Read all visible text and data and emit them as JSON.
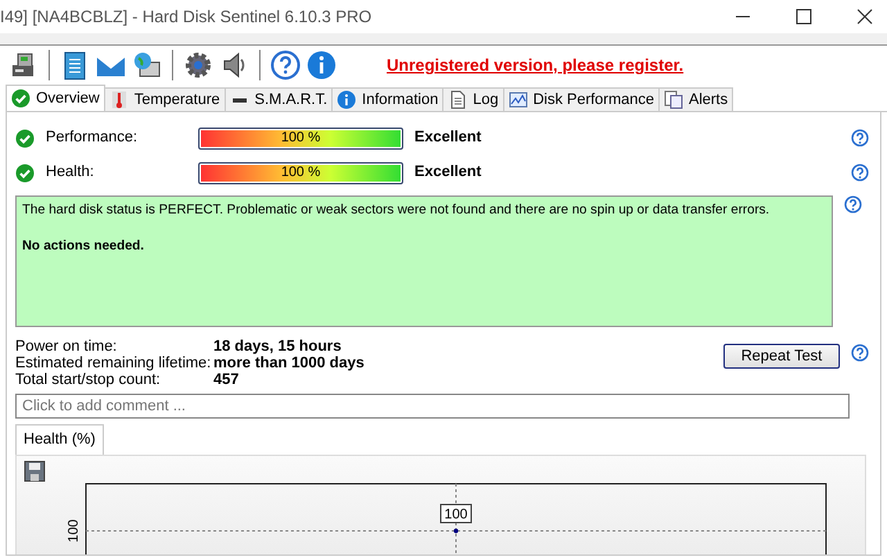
{
  "window": {
    "title": "I49]  [NA4BCBLZ] -  Hard Disk Sentinel 6.10.3 PRO"
  },
  "toolbar": {
    "notice": "Unregistered version, please register."
  },
  "tabs": [
    {
      "label": "Overview",
      "selected": true
    },
    {
      "label": "Temperature",
      "selected": false
    },
    {
      "label": "S.M.A.R.T.",
      "selected": false
    },
    {
      "label": "Information",
      "selected": false
    },
    {
      "label": "Log",
      "selected": false
    },
    {
      "label": "Disk Performance",
      "selected": false
    },
    {
      "label": "Alerts",
      "selected": false
    }
  ],
  "meters": [
    {
      "label": "Performance:",
      "level": 1.0,
      "reading": "100 %",
      "rating": "Excellent"
    },
    {
      "label": "Health:",
      "level": 1.0,
      "reading": "100 %",
      "rating": "Excellent"
    }
  ],
  "status": {
    "lines": [
      {
        "kind": "message",
        "text": "The hard disk status is PERFECT. Problematic or weak sectors were not found and there are no spin up or data transfer errors."
      },
      {
        "kind": "conclusion",
        "text": "No actions needed."
      }
    ]
  },
  "stats": [
    {
      "label": "Power on time:",
      "value": "18 days, 15 hours"
    },
    {
      "label": "Estimated remaining lifetime:",
      "value": "more than 1000 days"
    },
    {
      "label": "Total start/stop count:",
      "value": "457"
    }
  ],
  "repeat_button": "Repeat Test",
  "comment": {
    "placeholder": "Click to add comment ..."
  },
  "chart_tabs": [
    {
      "label": "Health (%)",
      "selected": true
    }
  ],
  "chart": {
    "y_tick_label": "100",
    "point_label": "100"
  }
}
